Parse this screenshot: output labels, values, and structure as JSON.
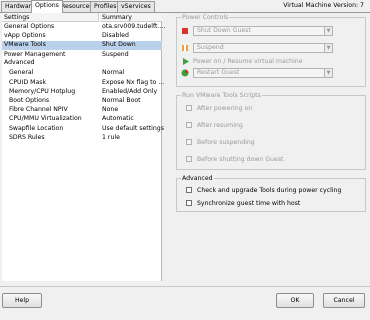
{
  "tabs": [
    "Hardware",
    "Options",
    "Resources",
    "Profiles",
    "vServices"
  ],
  "vm_version_label": "Virtual Machine Version: 7",
  "list": {
    "headers": [
      "Settings",
      "Summary"
    ],
    "rows": [
      {
        "key": "General Options",
        "value": "ota.srv009.tudelft...."
      },
      {
        "key": "vApp Options",
        "value": "Disabled"
      },
      {
        "key": "VMware Tools",
        "value": "Shut Down"
      },
      {
        "key": "Power Management",
        "value": "Suspend"
      },
      {
        "key": "Advanced",
        "value": ""
      },
      {
        "key": "General",
        "value": "Normal"
      },
      {
        "key": "CPUID Mask",
        "value": "Expose Nx flag to ..."
      },
      {
        "key": "Memory/CPU Hotplug",
        "value": "Enabled/Add Only"
      },
      {
        "key": "Boot Options",
        "value": "Normal Boot"
      },
      {
        "key": "Fibre Channel NPIV",
        "value": "None"
      },
      {
        "key": "CPU/MMU Virtualization",
        "value": "Automatic"
      },
      {
        "key": "Swapfile Location",
        "value": "Use default settings"
      },
      {
        "key": "SDRS Rules",
        "value": "1 rule"
      }
    ]
  },
  "power_controls": {
    "title": "Power Controls",
    "stop_value": "Shut Down Guest",
    "pause_value": "Suspend",
    "play_label": "Power on / Resume virtual machine",
    "restart_value": "Restart Guest"
  },
  "tools_scripts": {
    "title": "Run VMware Tools Scripts",
    "items": [
      "After powering on",
      "After resuming",
      "Before suspending",
      "Before shutting down Guest"
    ]
  },
  "advanced": {
    "title": "Advanced",
    "items": [
      "Check and upgrade Tools during power cycling",
      "Synchronize guest time with host"
    ]
  },
  "buttons": {
    "help": "Help",
    "ok": "OK",
    "cancel": "Cancel"
  },
  "colors": {
    "selection": "#b9d1ea",
    "stop": "#d9322a",
    "pause": "#e8a33c",
    "play": "#3aa33a"
  }
}
